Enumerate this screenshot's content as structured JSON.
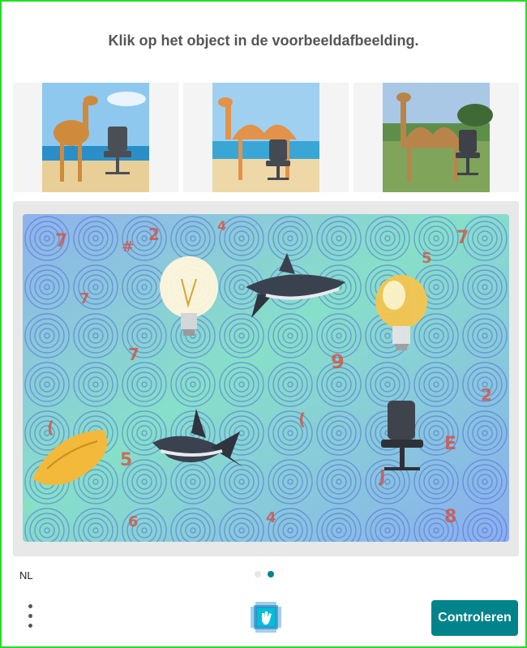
{
  "prompt": "Klik op het object in de voorbeeldafbeelding.",
  "examples": [
    {
      "name": "camel-with-office-chair-beach"
    },
    {
      "name": "camel-with-office-chair-sea"
    },
    {
      "name": "camel-with-office-chair-field"
    }
  ],
  "challenge_objects": [
    "light-bulb",
    "shark",
    "light-bulb",
    "shark",
    "office-chair",
    "sponge"
  ],
  "language": "NL",
  "pagination": {
    "total": 2,
    "current": 2
  },
  "submit_label": "Controleren",
  "colors": {
    "accent": "#00838a",
    "frame": "#22e022",
    "dot_active": "#00838a",
    "dot_inactive": "#e0e0e0"
  }
}
